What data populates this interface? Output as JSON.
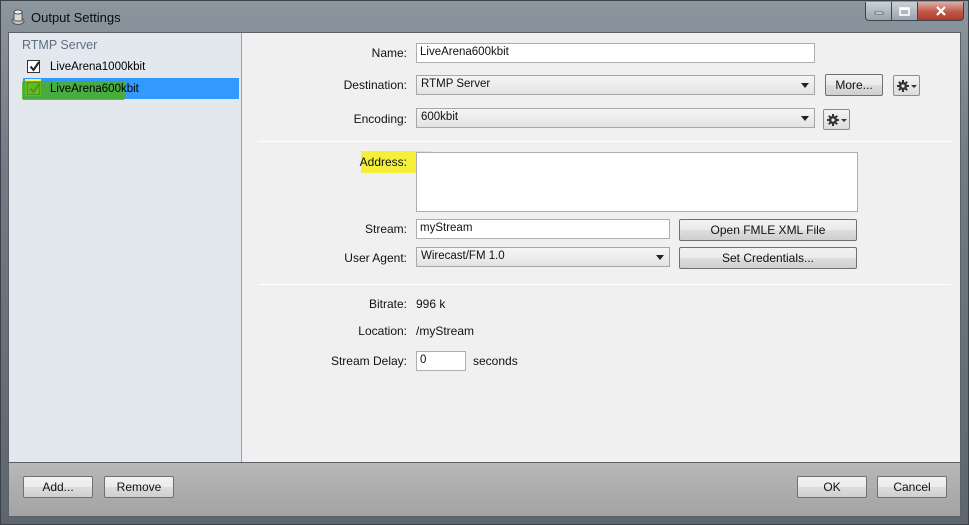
{
  "window": {
    "title": "Output Settings",
    "icon": "wirecast-icon"
  },
  "caption_buttons": {
    "minimize": "minimize-icon",
    "maximize": "maximize-icon",
    "close": "close-icon"
  },
  "sidebar": {
    "group": "RTMP Server",
    "items": [
      {
        "label": "LiveArena1000kbit",
        "checked": true,
        "selected": false
      },
      {
        "label": "LiveArena600kbit",
        "checked": true,
        "selected": true
      }
    ]
  },
  "form": {
    "name_label": "Name:",
    "name_value": "LiveArena600kbit",
    "destination_label": "Destination:",
    "destination_value": "RTMP Server",
    "more_button": "More...",
    "encoding_label": "Encoding:",
    "encoding_value": "600kbit",
    "address_label": "Address:",
    "address_value": "",
    "stream_label": "Stream:",
    "stream_value": "myStream",
    "open_fmle_button": "Open FMLE XML File",
    "user_agent_label": "User Agent:",
    "user_agent_value": "Wirecast/FM 1.0",
    "set_credentials_button": "Set Credentials...",
    "bitrate_label": "Bitrate:",
    "bitrate_value": "996 k",
    "location_label": "Location:",
    "location_value": "/myStream",
    "stream_delay_label": "Stream Delay:",
    "stream_delay_value": "0",
    "stream_delay_unit": "seconds"
  },
  "footer": {
    "add_button": "Add...",
    "remove_button": "Remove",
    "ok_button": "OK",
    "cancel_button": "Cancel"
  },
  "colors": {
    "selection": "#3399ff",
    "highlight_yellow": "#f4f03a",
    "highlight_green": "#4caf1f",
    "group_label": "#5e6f82"
  }
}
